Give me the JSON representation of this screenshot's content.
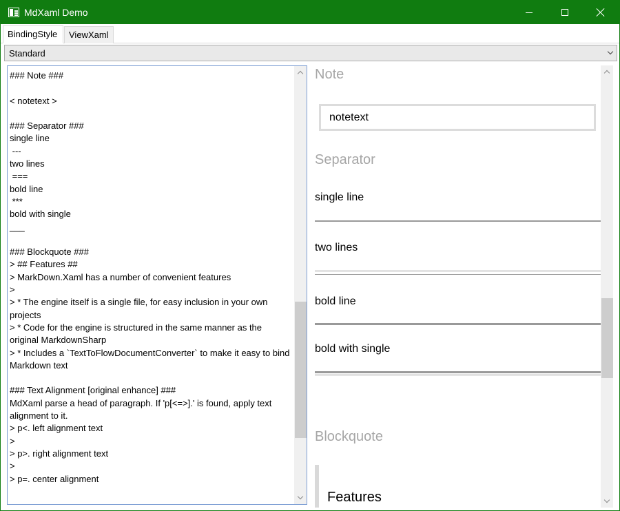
{
  "window": {
    "title": "MdXaml Demo"
  },
  "tabs": [
    {
      "label": "BindingStyle",
      "selected": true
    },
    {
      "label": "ViewXaml",
      "selected": false
    }
  ],
  "style_selector": {
    "value": "Standard"
  },
  "editor": {
    "lines": [
      "### Note ###",
      "",
      "< notetext >",
      "",
      "### Separator ###",
      "single line",
      " ---",
      "two lines",
      " ===",
      "bold line",
      " ***",
      "bold with single",
      "___",
      "",
      "### Blockquote ###",
      "> ## Features ##",
      "> MarkDown.Xaml has a number of convenient features",
      ">",
      "> * The engine itself is a single file, for easy inclusion in your own projects",
      "> * Code for the engine is structured in the same manner as the original MarkdownSharp",
      "> * Includes a `TextToFlowDocumentConverter` to make it easy to bind Markdown text",
      "",
      "### Text Alignment [original enhance] ###",
      "MdXaml parse a head of paragraph. If 'p[<=>].' is found, apply text alignment to it.",
      "> p<. left alignment text",
      ">",
      "> p>. right alignment text",
      ">",
      "> p=. center alignment"
    ]
  },
  "viewer": {
    "note_heading": "Note",
    "note_text": "notetext",
    "separator_heading": "Separator",
    "single_line": "single line",
    "two_lines": "two lines",
    "bold_line": "bold line",
    "bold_with_single": "bold with single",
    "blockquote_heading": "Blockquote",
    "features_heading": "Features"
  },
  "colors": {
    "titlebar": "#107c10",
    "editor_border": "#7a9cd3",
    "heading_gray": "#a6a6a6",
    "separator": "#999999"
  },
  "icons": [
    "app-icon",
    "minimize-icon",
    "maximize-icon",
    "close-icon",
    "chevron-down-icon",
    "scroll-up-icon",
    "scroll-down-icon"
  ]
}
